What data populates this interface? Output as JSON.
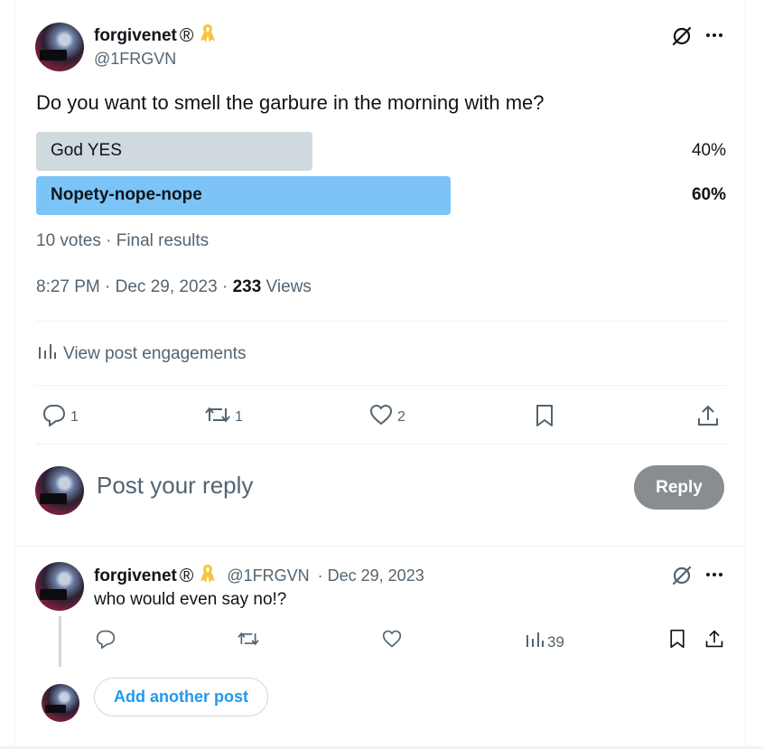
{
  "post": {
    "author_name": "forgivenet",
    "author_badge": "®",
    "author_handle": "@1FRGVN",
    "text": "Do you want to smell the garbure in the morning with me?",
    "poll": {
      "options": [
        {
          "label": "God YES",
          "percent": "40%",
          "fraction": 0.4,
          "winner": false
        },
        {
          "label": "Nopety-nope-nope",
          "percent": "60%",
          "fraction": 0.6,
          "winner": true
        }
      ],
      "summary": "10 votes · Final results"
    },
    "time": "8:27 PM · Dec 29, 2023 · ",
    "views_count": "233",
    "views_label": " Views",
    "engagements_label": "View post engagements",
    "actions": {
      "replies": "1",
      "reposts": "1",
      "likes": "2"
    }
  },
  "composer": {
    "placeholder": "Post your reply",
    "reply_button": "Reply"
  },
  "reply": {
    "author_name": "forgivenet",
    "author_badge": "®",
    "author_handle": "@1FRGVN",
    "date": "· Dec 29, 2023",
    "text": "who would even say no!?",
    "views": "39"
  },
  "thread": {
    "add_label": "Add another post"
  },
  "colors": {
    "winner_bar": "#7cc4f8",
    "loser_bar": "#cfd9de",
    "accent": "#1d9bf0",
    "ribbon": "#f4c542"
  },
  "icons": [
    "grok-icon",
    "more-icon",
    "ribbon-icon",
    "analytics-icon",
    "reply-icon",
    "repost-icon",
    "like-icon",
    "bookmark-icon",
    "share-icon"
  ]
}
